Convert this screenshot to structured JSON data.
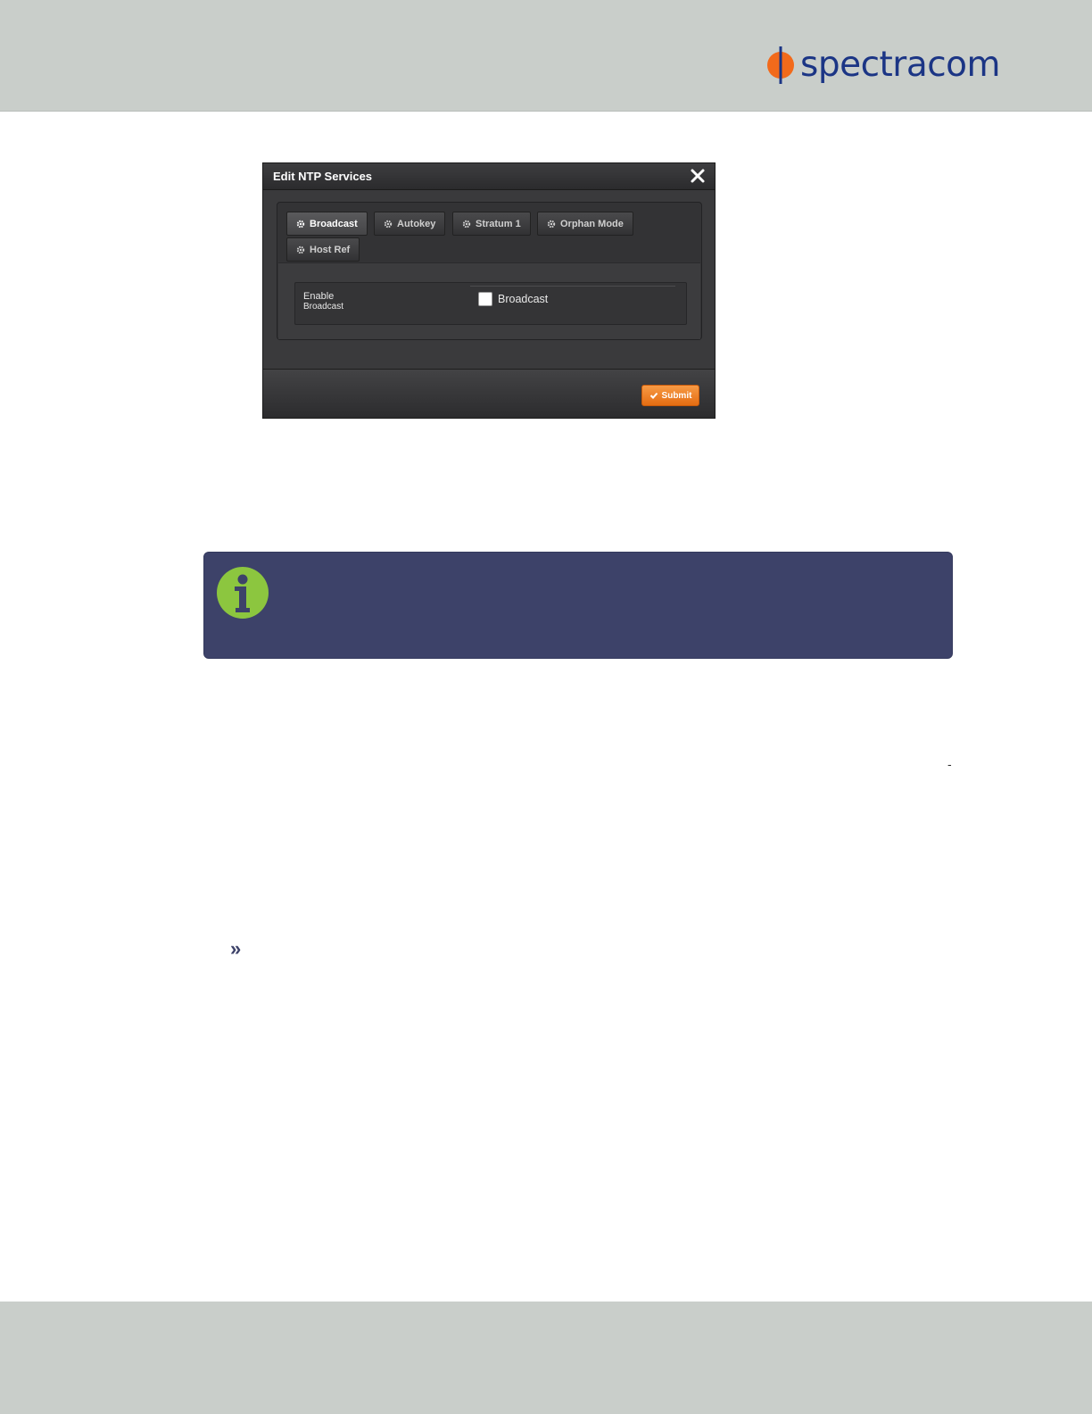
{
  "header": {
    "logo_text": "spectracom",
    "brand_color": "#1b3585",
    "mark_color": "#f26a1b"
  },
  "dialog": {
    "title": "Edit NTP Services",
    "close_icon": "close-icon",
    "tabs": [
      {
        "label": "Broadcast",
        "icon": "gear-icon",
        "active": true
      },
      {
        "label": "Autokey",
        "icon": "gear-icon",
        "active": false
      },
      {
        "label": "Stratum 1",
        "icon": "gear-icon",
        "active": false
      },
      {
        "label": "Orphan Mode",
        "icon": "gear-icon",
        "active": false
      },
      {
        "label": "Host Ref",
        "icon": "gear-icon",
        "active": false
      }
    ],
    "field": {
      "label_line1": "Enable",
      "label_line2": "Broadcast",
      "checkbox_label": "Broadcast",
      "checked": false
    },
    "submit_label": "Submit",
    "submit_color": "#f0822b"
  },
  "note": {
    "icon": "info-icon",
    "icon_color": "#8cc63f",
    "background": "#3d4269"
  },
  "body": {
    "dash": "-",
    "bullet": "»"
  }
}
